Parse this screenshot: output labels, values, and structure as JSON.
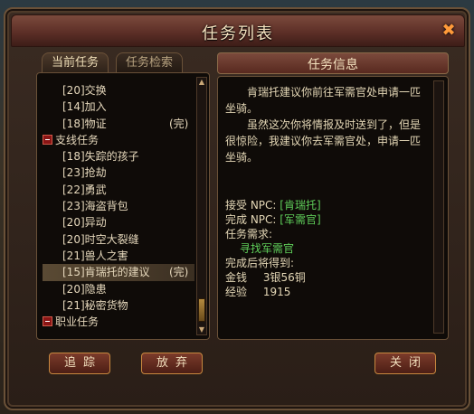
{
  "window": {
    "title": "任务列表",
    "close_symbol": "✖"
  },
  "tabs": [
    {
      "label": "当前任务",
      "active": true
    },
    {
      "label": "任务检索",
      "active": false
    }
  ],
  "quest_list": [
    {
      "name": "[20]交换",
      "status": "",
      "type": "quest"
    },
    {
      "name": "[14]加入",
      "status": "",
      "type": "quest"
    },
    {
      "name": "[18]物证",
      "status": "(完)",
      "type": "quest"
    },
    {
      "name": "支线任务",
      "status": "",
      "type": "category"
    },
    {
      "name": "[18]失踪的孩子",
      "status": "",
      "type": "quest"
    },
    {
      "name": "[23]抢劫",
      "status": "",
      "type": "quest"
    },
    {
      "name": "[22]勇武",
      "status": "",
      "type": "quest"
    },
    {
      "name": "[23]海盗背包",
      "status": "",
      "type": "quest"
    },
    {
      "name": "[20]异动",
      "status": "",
      "type": "quest"
    },
    {
      "name": "[20]时空大裂缝",
      "status": "",
      "type": "quest"
    },
    {
      "name": "[21]兽人之害",
      "status": "",
      "type": "quest"
    },
    {
      "name": "[15]肯瑞托的建议",
      "status": "(完)",
      "type": "quest",
      "selected": true
    },
    {
      "name": "[20]隐患",
      "status": "",
      "type": "quest"
    },
    {
      "name": "[21]秘密货物",
      "status": "",
      "type": "quest"
    },
    {
      "name": "职业任务",
      "status": "",
      "type": "category"
    }
  ],
  "info": {
    "header": "任务信息",
    "paragraph1": "肯瑞托建议你前往军需官处申请一匹坐骑。",
    "paragraph2": "虽然这次你将情报及时送到了，但是很惊险，我建议你去军需官处，申请一匹坐骑。",
    "accept_label": "接受 NPC:",
    "accept_npc": "[肯瑞托]",
    "complete_label": "完成 NPC:",
    "complete_npc": "[军需官]",
    "requirement_label": "任务需求:",
    "requirement_text": "寻找军需官",
    "reward_label": "完成后将得到:",
    "gold_label": "金钱",
    "gold_value": "3银56铜",
    "exp_label": "经验",
    "exp_value": "1915"
  },
  "buttons": {
    "track": "追踪",
    "abandon": "放弃",
    "close": "关闭"
  },
  "colors": {
    "green_text": "#5fcf5a",
    "title_text": "#f5e3c0"
  }
}
